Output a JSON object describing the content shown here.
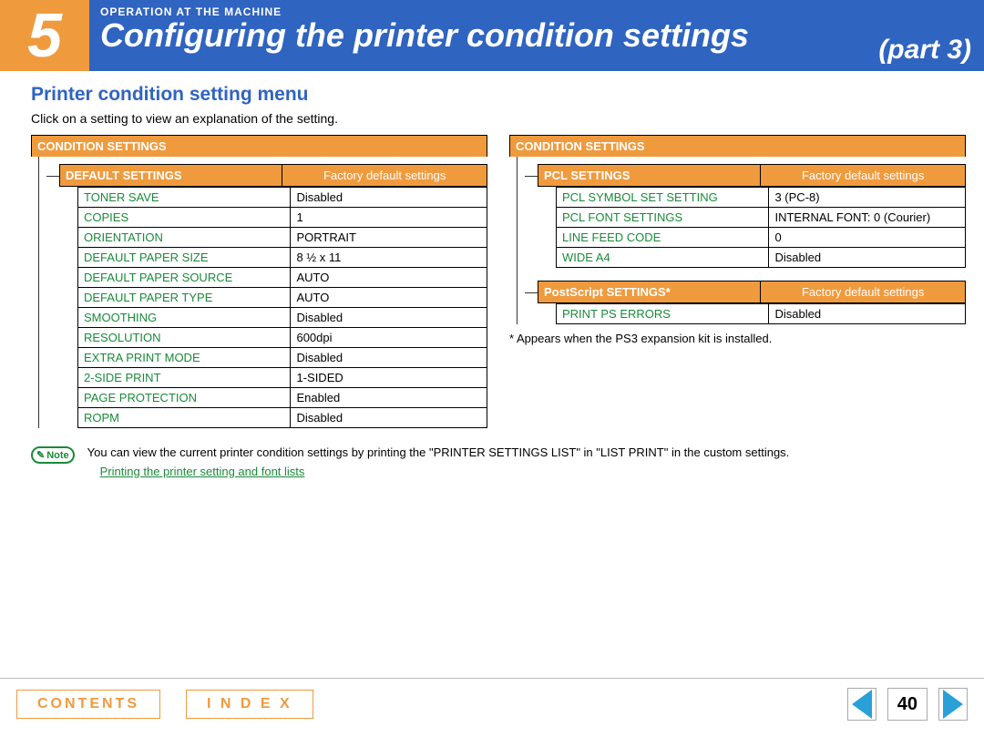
{
  "header": {
    "chapter_number": "5",
    "kicker": "OPERATION AT THE MACHINE",
    "title": "Configuring the printer condition settings",
    "part": "(part 3)"
  },
  "section_title": "Printer condition setting menu",
  "intro": "Click on a setting to view an explanation of the setting.",
  "left": {
    "block_header": "CONDITION SETTINGS",
    "sub_header_left": "DEFAULT SETTINGS",
    "sub_header_right": "Factory default settings",
    "rows": [
      {
        "k": "TONER SAVE",
        "v": "Disabled"
      },
      {
        "k": "COPIES",
        "v": "1"
      },
      {
        "k": "ORIENTATION",
        "v": "PORTRAIT"
      },
      {
        "k": "DEFAULT PAPER SIZE",
        "v": "8 ½ x 11"
      },
      {
        "k": "DEFAULT PAPER SOURCE",
        "v": "AUTO"
      },
      {
        "k": "DEFAULT PAPER TYPE",
        "v": "AUTO"
      },
      {
        "k": "SMOOTHING",
        "v": "Disabled"
      },
      {
        "k": "RESOLUTION",
        "v": "600dpi"
      },
      {
        "k": "EXTRA PRINT MODE",
        "v": "Disabled"
      },
      {
        "k": "2-SIDE PRINT",
        "v": "1-SIDED"
      },
      {
        "k": "PAGE PROTECTION",
        "v": "Enabled"
      },
      {
        "k": "ROPM",
        "v": "Disabled"
      }
    ]
  },
  "right": {
    "block_header": "CONDITION SETTINGS",
    "pcl": {
      "sub_header_left": "PCL SETTINGS",
      "sub_header_right": "Factory default settings",
      "rows": [
        {
          "k": "PCL SYMBOL SET SETTING",
          "v": "3 (PC-8)"
        },
        {
          "k": "PCL FONT SETTINGS",
          "v": "INTERNAL FONT: 0 (Courier)"
        },
        {
          "k": "LINE FEED CODE",
          "v": "0"
        },
        {
          "k": "WIDE A4",
          "v": "Disabled"
        }
      ]
    },
    "ps": {
      "sub_header_left": "PostScript SETTINGS*",
      "sub_header_right": "Factory default settings",
      "rows": [
        {
          "k": "PRINT PS ERRORS",
          "v": "Disabled"
        }
      ]
    },
    "footnote": "* Appears when the PS3 expansion kit is installed."
  },
  "note": {
    "badge": "Note",
    "text": "You can view the current printer condition settings by printing the \"PRINTER SETTINGS LIST\" in \"LIST PRINT\" in the custom settings.",
    "link": "Printing the printer setting and font lists"
  },
  "footer": {
    "contents": "CONTENTS",
    "index": "I N D E X",
    "page": "40"
  }
}
